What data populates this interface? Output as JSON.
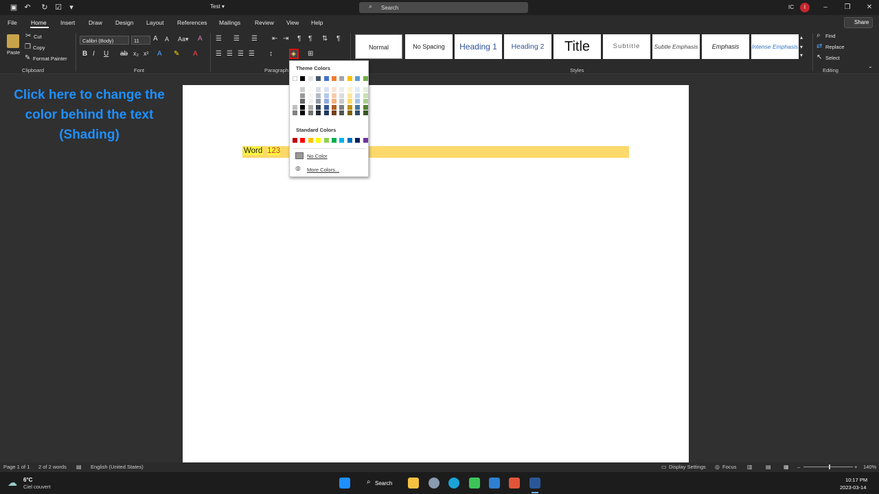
{
  "titlebar": {
    "doc_title": "Test ▾",
    "search_label": "Search",
    "user_initials": "IC",
    "avatar_letter": "I"
  },
  "tabs": [
    "File",
    "Home",
    "Insert",
    "Draw",
    "Design",
    "Layout",
    "References",
    "Mailings",
    "Review",
    "View",
    "Help"
  ],
  "share_label": "Share",
  "clipboard": {
    "paste": "Paste",
    "cut": "Cut",
    "copy": "Copy",
    "format_painter": "Format Painter",
    "label": "Clipboard"
  },
  "font": {
    "name": "Calibri (Body)",
    "size": "11",
    "label": "Font"
  },
  "paragraph_label": "Paragraph",
  "styles": {
    "items": [
      "Normal",
      "No Spacing",
      "Heading 1",
      "Heading 2",
      "Title",
      "Subtitle",
      "Subtle Emphasis",
      "Emphasis",
      "Intense Emphasis"
    ],
    "label": "Styles"
  },
  "editing": {
    "find": "Find",
    "replace": "Replace",
    "select": "Select",
    "label": "Editing"
  },
  "tip": "Click here to change the color behind the text (Shading)",
  "document": {
    "word": "Word",
    "number": "123"
  },
  "dropdown": {
    "theme_heading": "Theme Colors",
    "standard_heading": "Standard Colors",
    "no_color": "No Color",
    "more_colors": "More Colors...",
    "theme_base": [
      "#ffffff",
      "#000000",
      "#e7e6e6",
      "#44546a",
      "#4472c4",
      "#ed7d31",
      "#a5a5a5",
      "#ffc000",
      "#5b9bd5",
      "#70ad47"
    ],
    "standard": [
      "#c00000",
      "#ff0000",
      "#ffc000",
      "#ffff00",
      "#92d050",
      "#00b050",
      "#00b0f0",
      "#0070c0",
      "#002060",
      "#7030a0"
    ]
  },
  "statusbar": {
    "page": "Page 1 of 1",
    "words": "2 of 2 words",
    "language": "English (United States)",
    "display": "Display Settings",
    "focus": "Focus",
    "zoom": "140%"
  },
  "taskbar": {
    "temp": "6°C",
    "weather": "Ciel couvert",
    "search": "Search",
    "time": "10:17 PM",
    "date": "2023-03-14"
  }
}
